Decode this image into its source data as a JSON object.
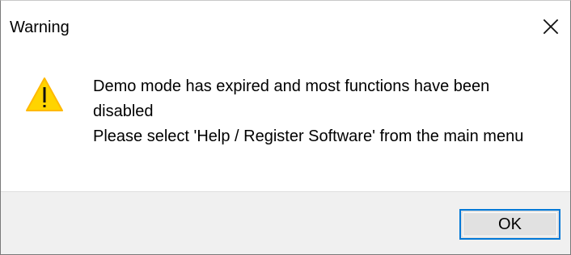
{
  "window": {
    "title": "Warning",
    "close_icon": "close-icon"
  },
  "message": {
    "icon": "warning-icon",
    "line1": "Demo mode has expired and most functions have been disabled",
    "line2": "Please select 'Help / Register Software' from the main menu"
  },
  "buttons": {
    "ok_label": "OK"
  },
  "colors": {
    "accent": "#0078d7",
    "warning_fill": "#ffd400",
    "warning_border": "#ffb900"
  }
}
